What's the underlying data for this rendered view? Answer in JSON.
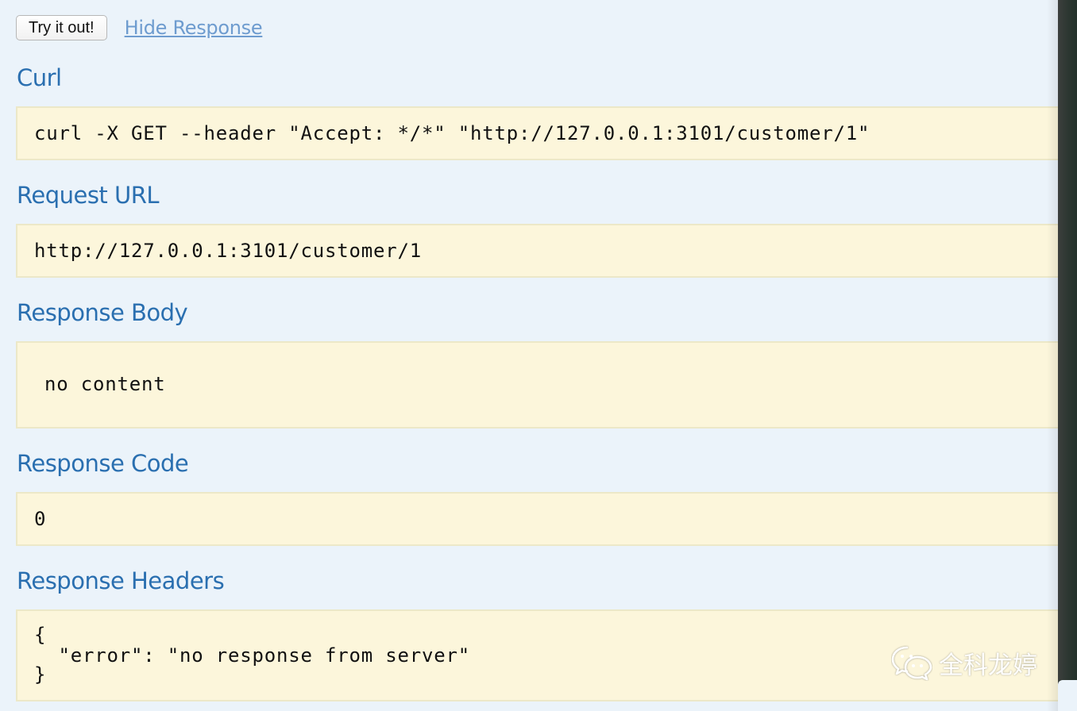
{
  "toolbar": {
    "try_button": "Try it out!",
    "hide_link": "Hide Response"
  },
  "sections": {
    "curl": {
      "title": "Curl",
      "value": "curl -X GET --header \"Accept: */*\" \"http://127.0.0.1:3101/customer/1\""
    },
    "request_url": {
      "title": "Request URL",
      "value": "http://127.0.0.1:3101/customer/1"
    },
    "response_body": {
      "title": "Response Body",
      "value": "no content"
    },
    "response_code": {
      "title": "Response Code",
      "value": "0"
    },
    "response_headers": {
      "title": "Response Headers",
      "lines": [
        "{",
        "  \"error\": \"no response from server\"",
        "}"
      ]
    }
  },
  "watermark": {
    "icon": "wechat-icon",
    "text": "全科龙婷"
  }
}
